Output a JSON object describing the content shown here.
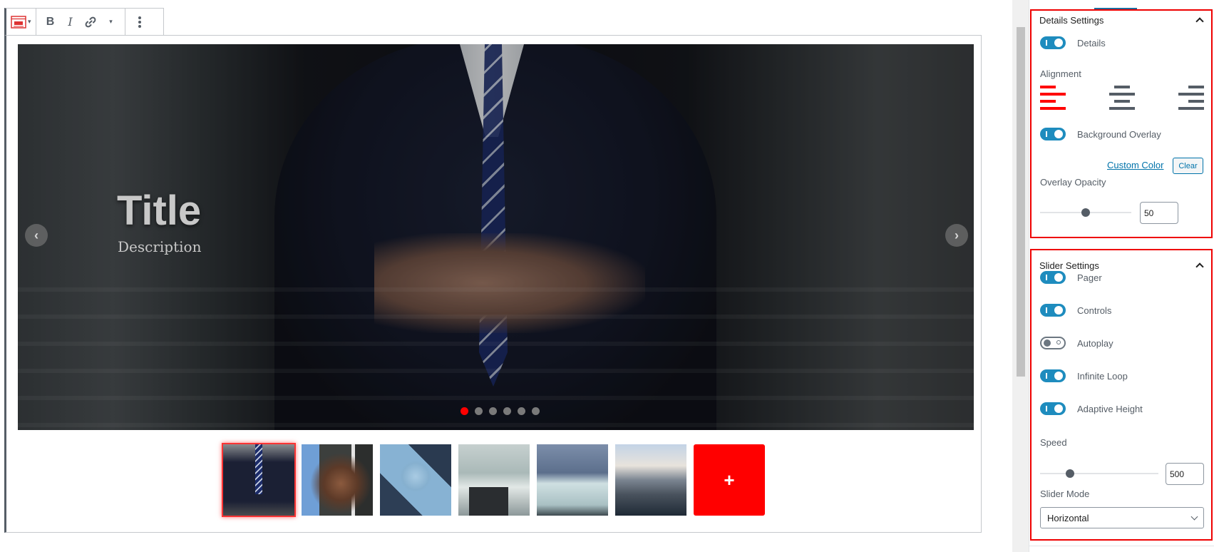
{
  "toolbar": {
    "block_icon": "slider-block-icon",
    "bold_label": "B",
    "italic_label": "I",
    "link_icon": "link-icon",
    "more_icon": "more-options-icon",
    "dropdown_caret": "▾"
  },
  "slider": {
    "title": "Title",
    "description": "Description",
    "prev_arrow": "‹",
    "next_arrow": "›",
    "pager_count": 6,
    "active_slide": 1,
    "thumbnails": [
      {
        "subject": "businessman buttoning suit",
        "active": true
      },
      {
        "subject": "handshake",
        "active": false
      },
      {
        "subject": "skyscrapers from below",
        "active": false
      },
      {
        "subject": "laptops and paperwork",
        "active": false
      },
      {
        "subject": "signing document",
        "active": false
      },
      {
        "subject": "city skyline",
        "active": false
      }
    ],
    "add_slide_label": "+"
  },
  "colors": {
    "accent_red": "#ff0000",
    "toggle_blue": "#1e8cbe",
    "link_blue": "#0073aa"
  },
  "details_settings": {
    "heading": "Details Settings",
    "details_toggle": {
      "label": "Details",
      "on": true
    },
    "alignment_label": "Alignment",
    "alignment_options": [
      "left",
      "center",
      "right"
    ],
    "alignment_selected": "left",
    "background_overlay_toggle": {
      "label": "Background Overlay",
      "on": true
    },
    "custom_color_label": "Custom Color",
    "clear_label": "Clear",
    "overlay_opacity_label": "Overlay Opacity",
    "overlay_opacity_value": "50",
    "overlay_opacity_percent": 50
  },
  "slider_settings": {
    "heading": "Slider Settings",
    "toggles": [
      {
        "label": "Pager",
        "on": true
      },
      {
        "label": "Controls",
        "on": true
      },
      {
        "label": "Autoplay",
        "on": false
      },
      {
        "label": "Infinite Loop",
        "on": true
      },
      {
        "label": "Adaptive Height",
        "on": true
      }
    ],
    "speed_label": "Speed",
    "speed_value": "500",
    "speed_fraction": 0.25,
    "slider_mode_label": "Slider Mode",
    "slider_mode_value": "Horizontal"
  }
}
